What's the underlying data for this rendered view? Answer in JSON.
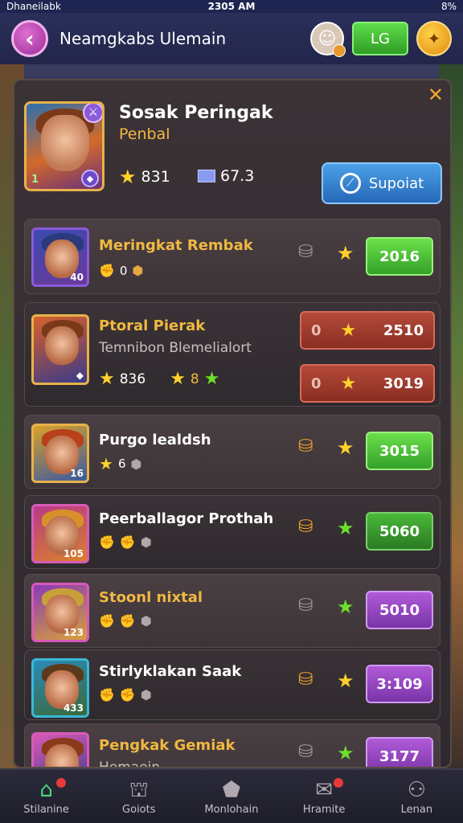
{
  "status_bar": {
    "carrier": "Dhaneilabk",
    "time": "2305 AM",
    "battery": "8%"
  },
  "header": {
    "back_icon": "‹",
    "title": "Neamgkabs Ulemain",
    "lg_label": "LG"
  },
  "hero": {
    "name": "Sosak Peringak",
    "subtitle": "Penbal",
    "level": "1",
    "stars": "831",
    "gems": "67.3",
    "support_label": "Supoiat"
  },
  "rows": [
    {
      "title": "Meringkat Rembak",
      "badge": "40",
      "meta1": "0",
      "value": "2016",
      "value_style": "green",
      "pot": "grey",
      "star": "yellow"
    },
    {
      "title": "Ptoral Pierak",
      "sub": "Temnibon Blemelialort",
      "badge": "",
      "stars": "836",
      "meta2": "8",
      "buttons": [
        {
          "zero": "0",
          "value": "2510"
        },
        {
          "zero": "0",
          "value": "3019"
        }
      ]
    },
    {
      "title": "Purgo lealdsh",
      "badge": "16",
      "meta1": "6",
      "value": "3015",
      "value_style": "green",
      "pot": "orange",
      "star": "yellow"
    },
    {
      "title": "Peerballagor Prothah",
      "badge": "105",
      "value": "5060",
      "value_style": "dkgreen",
      "pot": "orange",
      "star": "green"
    },
    {
      "title": "Stoonl nixtal",
      "badge": "123",
      "value": "5010",
      "value_style": "purple",
      "pot": "grey",
      "star": "green"
    },
    {
      "title": "Stirlyklakan Saak",
      "badge": "433",
      "value": "3:109",
      "value_style": "purple",
      "pot": "orange",
      "star": "yellow"
    },
    {
      "title": "Pengkak Gemiak",
      "sub": "Hemaein",
      "value": "3177",
      "value_style": "purple",
      "pot": "grey",
      "star": "green"
    }
  ],
  "nav": [
    {
      "label": "Stilanine",
      "icon": "home-icon",
      "active": true
    },
    {
      "label": "Goiots",
      "icon": "bag-icon"
    },
    {
      "label": "Monlohain",
      "icon": "shield-icon"
    },
    {
      "label": "Hramite",
      "icon": "mail-icon"
    },
    {
      "label": "Lenan",
      "icon": "users-icon"
    }
  ],
  "colors": {
    "accent_gold": "#f0b840",
    "green_btn": "#34a02a",
    "purple_btn": "#7a34a8",
    "red_btn": "#8a2e22"
  }
}
